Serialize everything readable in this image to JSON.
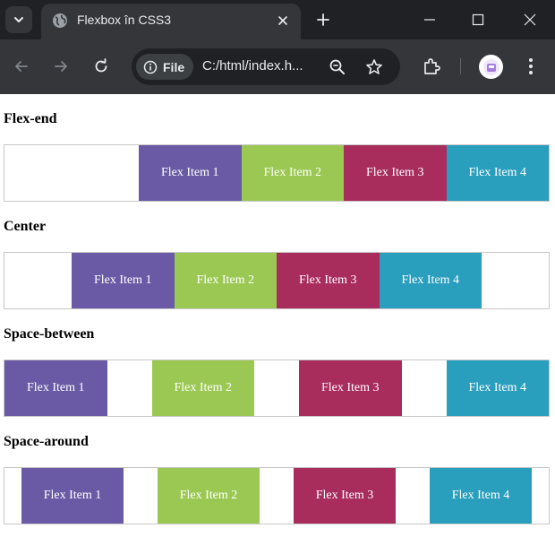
{
  "browser": {
    "tab_title": "Flexbox în CSS3",
    "site_chip_label": "File",
    "url": "C:/html/index.h..."
  },
  "colors": {
    "item1": "#6a5aa5",
    "item2": "#9bc853",
    "item3": "#a82c5c",
    "item4": "#2a9ebd"
  },
  "sections": [
    {
      "title": "Flex-end",
      "justify": "flex-end",
      "items": [
        "Flex Item 1",
        "Flex Item 2",
        "Flex Item 3",
        "Flex Item 4"
      ]
    },
    {
      "title": "Center",
      "justify": "center",
      "items": [
        "Flex Item 1",
        "Flex Item 2",
        "Flex Item 3",
        "Flex Item 4"
      ]
    },
    {
      "title": "Space-between",
      "justify": "space-between",
      "items": [
        "Flex Item 1",
        "Flex Item 2",
        "Flex Item 3",
        "Flex Item 4"
      ]
    },
    {
      "title": "Space-around",
      "justify": "space-around",
      "items": [
        "Flex Item 1",
        "Flex Item 2",
        "Flex Item 3",
        "Flex Item 4"
      ]
    }
  ]
}
